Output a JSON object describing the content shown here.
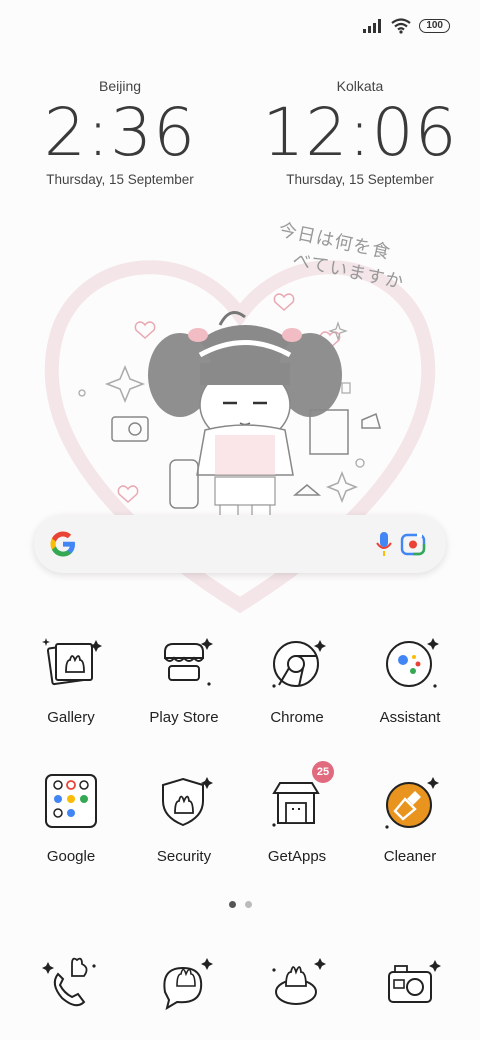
{
  "status": {
    "battery": "100"
  },
  "clocks": [
    {
      "city": "Beijing",
      "time": "2:36",
      "date": "Thursday, 15 September"
    },
    {
      "city": "Kolkata",
      "time": "12:06",
      "date": "Thursday, 15 September"
    }
  ],
  "wallpaper": {
    "text_line1": "今日は何を食",
    "text_line2": "べていますか"
  },
  "apps_row1": [
    {
      "label": "Gallery",
      "icon": "gallery-icon"
    },
    {
      "label": "Play Store",
      "icon": "play-store-icon"
    },
    {
      "label": "Chrome",
      "icon": "chrome-icon"
    },
    {
      "label": "Assistant",
      "icon": "assistant-icon"
    }
  ],
  "apps_row2": [
    {
      "label": "Google",
      "icon": "google-folder-icon"
    },
    {
      "label": "Security",
      "icon": "security-icon"
    },
    {
      "label": "GetApps",
      "icon": "getapps-icon",
      "badge": "25"
    },
    {
      "label": "Cleaner",
      "icon": "cleaner-icon"
    }
  ],
  "dock": [
    {
      "icon": "phone-icon"
    },
    {
      "icon": "messages-icon"
    },
    {
      "icon": "browser-icon"
    },
    {
      "icon": "camera-icon"
    }
  ],
  "colors": {
    "badge": "#e26a7e",
    "cleaner": "#e8941f"
  }
}
